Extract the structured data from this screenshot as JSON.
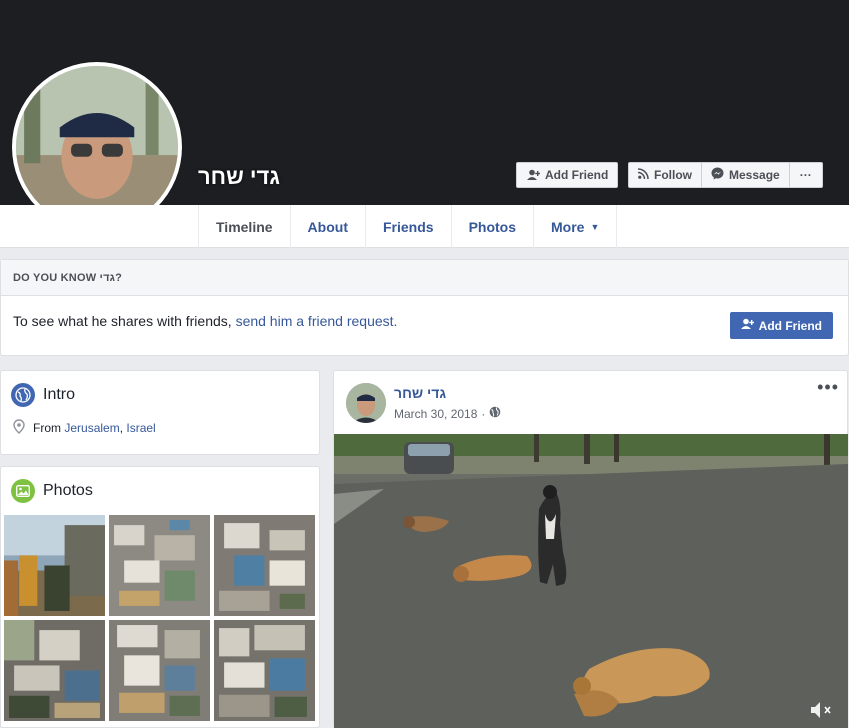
{
  "profile": {
    "name": "גדי שחר",
    "add_friend_label": "Add Friend",
    "follow_label": "Follow",
    "message_label": "Message",
    "more_label": "···"
  },
  "tabs": [
    {
      "label": "Timeline"
    },
    {
      "label": "About"
    },
    {
      "label": "Friends"
    },
    {
      "label": "Photos"
    },
    {
      "label": "More"
    }
  ],
  "dyk": {
    "heading": "DO YOU KNOW גדי?",
    "text": "To see what he shares with friends, ",
    "link": "send him a friend request.",
    "button": "Add Friend"
  },
  "intro": {
    "title": "Intro",
    "from_label": "From",
    "city": "Jerusalem",
    "sep": ", ",
    "country": "Israel"
  },
  "photos": {
    "title": "Photos"
  },
  "post": {
    "author": "גדי שחר",
    "date": "March 30, 2018",
    "dot": "·",
    "more": "•••"
  },
  "colors": {
    "cover": "#1d1e22",
    "link": "#365899",
    "primary_button": "#4267b2",
    "intro_icon": "#4267b2",
    "photos_icon": "#7fc242"
  },
  "icons": {
    "add_friend": "person-plus-icon",
    "follow": "rss-icon",
    "message": "messenger-icon",
    "intro": "globe-icon",
    "location": "map-pin-icon",
    "photos": "image-icon",
    "privacy": "globe-icon",
    "mute": "speaker-muted-icon"
  }
}
